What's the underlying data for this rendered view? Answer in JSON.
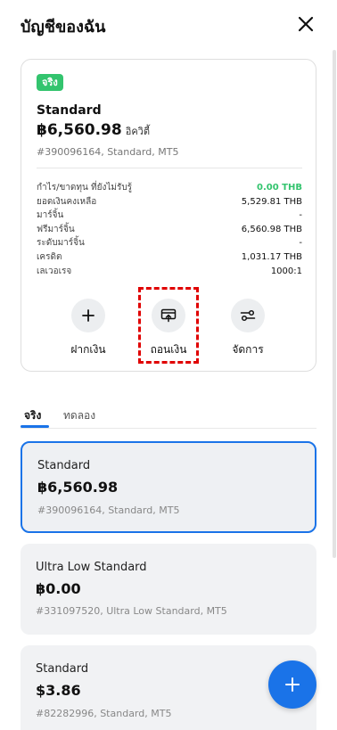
{
  "header": {
    "title": "บัญชีของฉัน",
    "close_icon": "close-icon"
  },
  "summary": {
    "badge": "จริง",
    "account_name": "Standard",
    "balance": "฿6,560.98",
    "balance_suffix": "อิควิตี้",
    "account_id": "#390096164, Standard, MT5",
    "stats": [
      {
        "label": "กำไร/ขาดทุน ที่ยังไม่รับรู้",
        "value": "0.00 THB",
        "positive": true
      },
      {
        "label": "ยอดเงินคงเหลือ",
        "value": "5,529.81 THB",
        "positive": false
      },
      {
        "label": "มาร์จิ้น",
        "value": "-",
        "positive": false
      },
      {
        "label": "ฟรีมาร์จิ้น",
        "value": "6,560.98 THB",
        "positive": false
      },
      {
        "label": "ระดับมาร์จิ้น",
        "value": "-",
        "positive": false
      },
      {
        "label": "เครดิต",
        "value": "1,031.17 THB",
        "positive": false
      },
      {
        "label": "เลเวอเรจ",
        "value": "1000:1",
        "positive": false
      }
    ],
    "actions": [
      {
        "label": "ฝากเงิน",
        "icon": "plus-icon"
      },
      {
        "label": "ถอนเงิน",
        "icon": "withdraw-icon",
        "highlighted": true
      },
      {
        "label": "จัดการ",
        "icon": "manage-icon"
      }
    ]
  },
  "tabs": [
    {
      "label": "จริง",
      "active": true
    },
    {
      "label": "ทดลอง",
      "active": false
    }
  ],
  "accounts": [
    {
      "name": "Standard",
      "balance": "฿6,560.98",
      "id": "#390096164, Standard, MT5",
      "selected": true
    },
    {
      "name": "Ultra Low Standard",
      "balance": "฿0.00",
      "id": "#331097520, Ultra Low Standard, MT5",
      "selected": false
    },
    {
      "name": "Standard",
      "balance": "$3.86",
      "id": "#82282996, Standard, MT5",
      "selected": false
    }
  ],
  "fab": {
    "icon": "plus-icon"
  },
  "colors": {
    "accent": "#1a73e8",
    "positive": "#33c46e",
    "highlight": "#e00000"
  }
}
